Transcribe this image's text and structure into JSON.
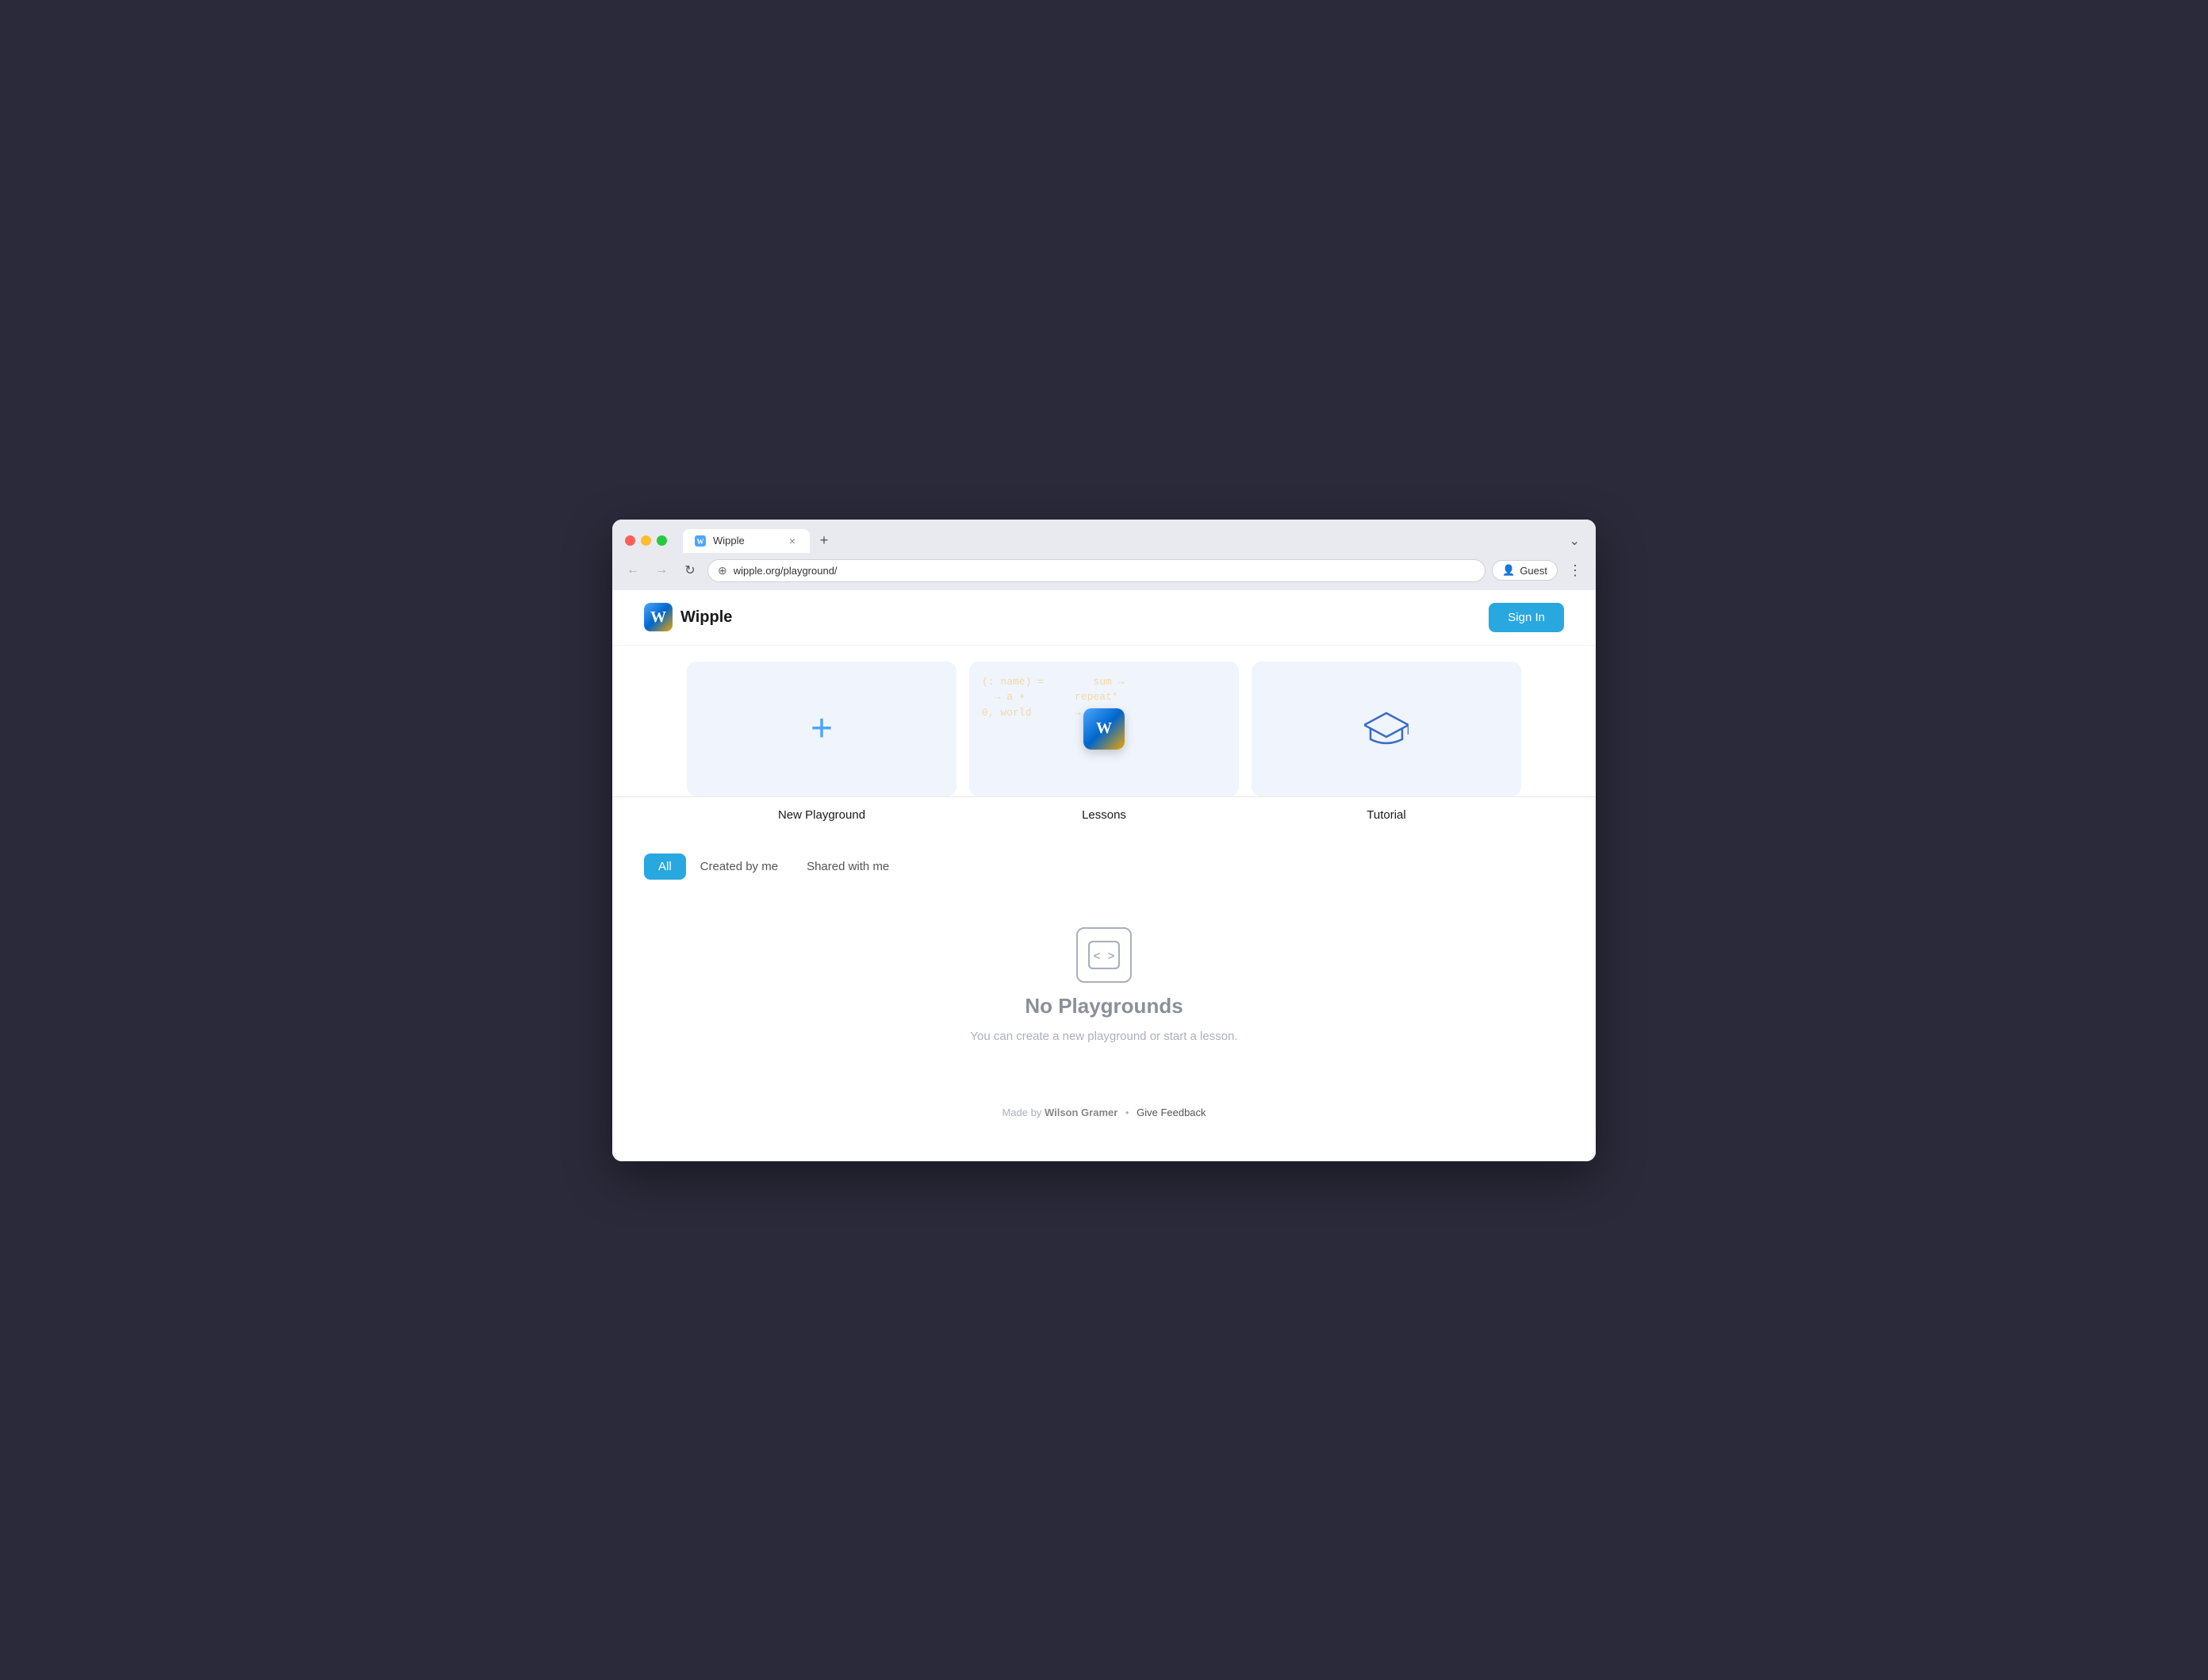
{
  "browser": {
    "url": "wipple.org/playground/",
    "tab_title": "Wipple",
    "profile_label": "Guest",
    "new_tab_icon": "+",
    "expand_icon": "⌄",
    "back_icon": "←",
    "forward_icon": "→",
    "refresh_icon": "↻",
    "more_icon": "⋮"
  },
  "header": {
    "logo_letter": "W",
    "app_name": "Wipple",
    "sign_in_label": "Sign In"
  },
  "cards": [
    {
      "id": "new-playground",
      "label": "New Playground",
      "icon_type": "plus"
    },
    {
      "id": "lessons",
      "label": "Lessons",
      "icon_type": "wipple-logo",
      "code_snippets": [
        "(: name) =",
        "  → a +",
        "0, world",
        "  sum →",
        "  repeat*",
        "  → to"
      ]
    },
    {
      "id": "tutorial",
      "label": "Tutorial",
      "icon_type": "graduation"
    }
  ],
  "tabs": [
    {
      "id": "all",
      "label": "All",
      "active": true
    },
    {
      "id": "created-by-me",
      "label": "Created by me",
      "active": false
    },
    {
      "id": "shared-with-me",
      "label": "Shared with me",
      "active": false
    }
  ],
  "empty_state": {
    "icon_text": "<>",
    "title": "No Playgrounds",
    "subtitle": "You can create a new playground or start a lesson."
  },
  "footer": {
    "made_by_label": "Made by",
    "author": "Wilson Gramer",
    "dot": "•",
    "feedback_label": "Give Feedback"
  }
}
